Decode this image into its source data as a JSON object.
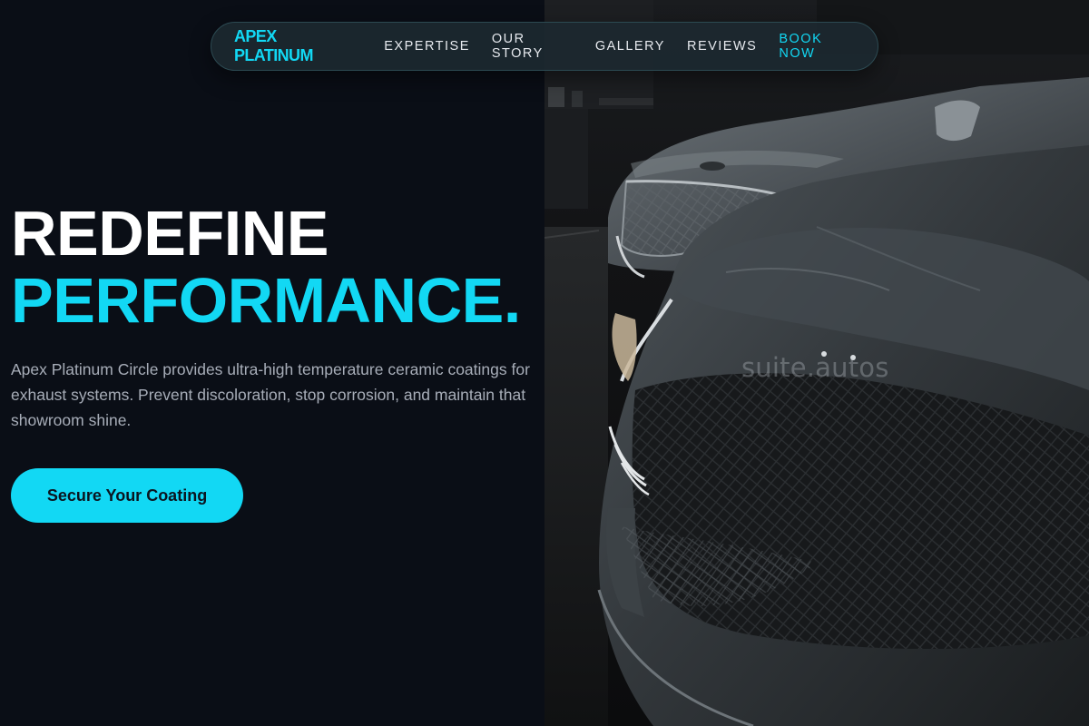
{
  "nav": {
    "brand": "APEX PLATINUM",
    "links": [
      "EXPERTISE",
      "OUR STORY",
      "GALLERY",
      "REVIEWS"
    ],
    "cta_label": "BOOK NOW"
  },
  "hero": {
    "headline_line1": "REDEFINE",
    "headline_line2": "PERFORMANCE.",
    "description": "Apex Platinum Circle provides ultra-high temperature ceramic coatings for exhaust systems. Prevent discoloration, stop corrosion, and maintain that showroom shine.",
    "cta_label": "Secure Your Coating"
  },
  "photo": {
    "subject": "dark-grey-sports-cars-in-garage",
    "watermark": "suite.autos"
  },
  "colors": {
    "accent": "#12d8f4",
    "background": "#0a0e16",
    "text_primary": "#ffffff",
    "text_muted": "#a7adb8"
  }
}
